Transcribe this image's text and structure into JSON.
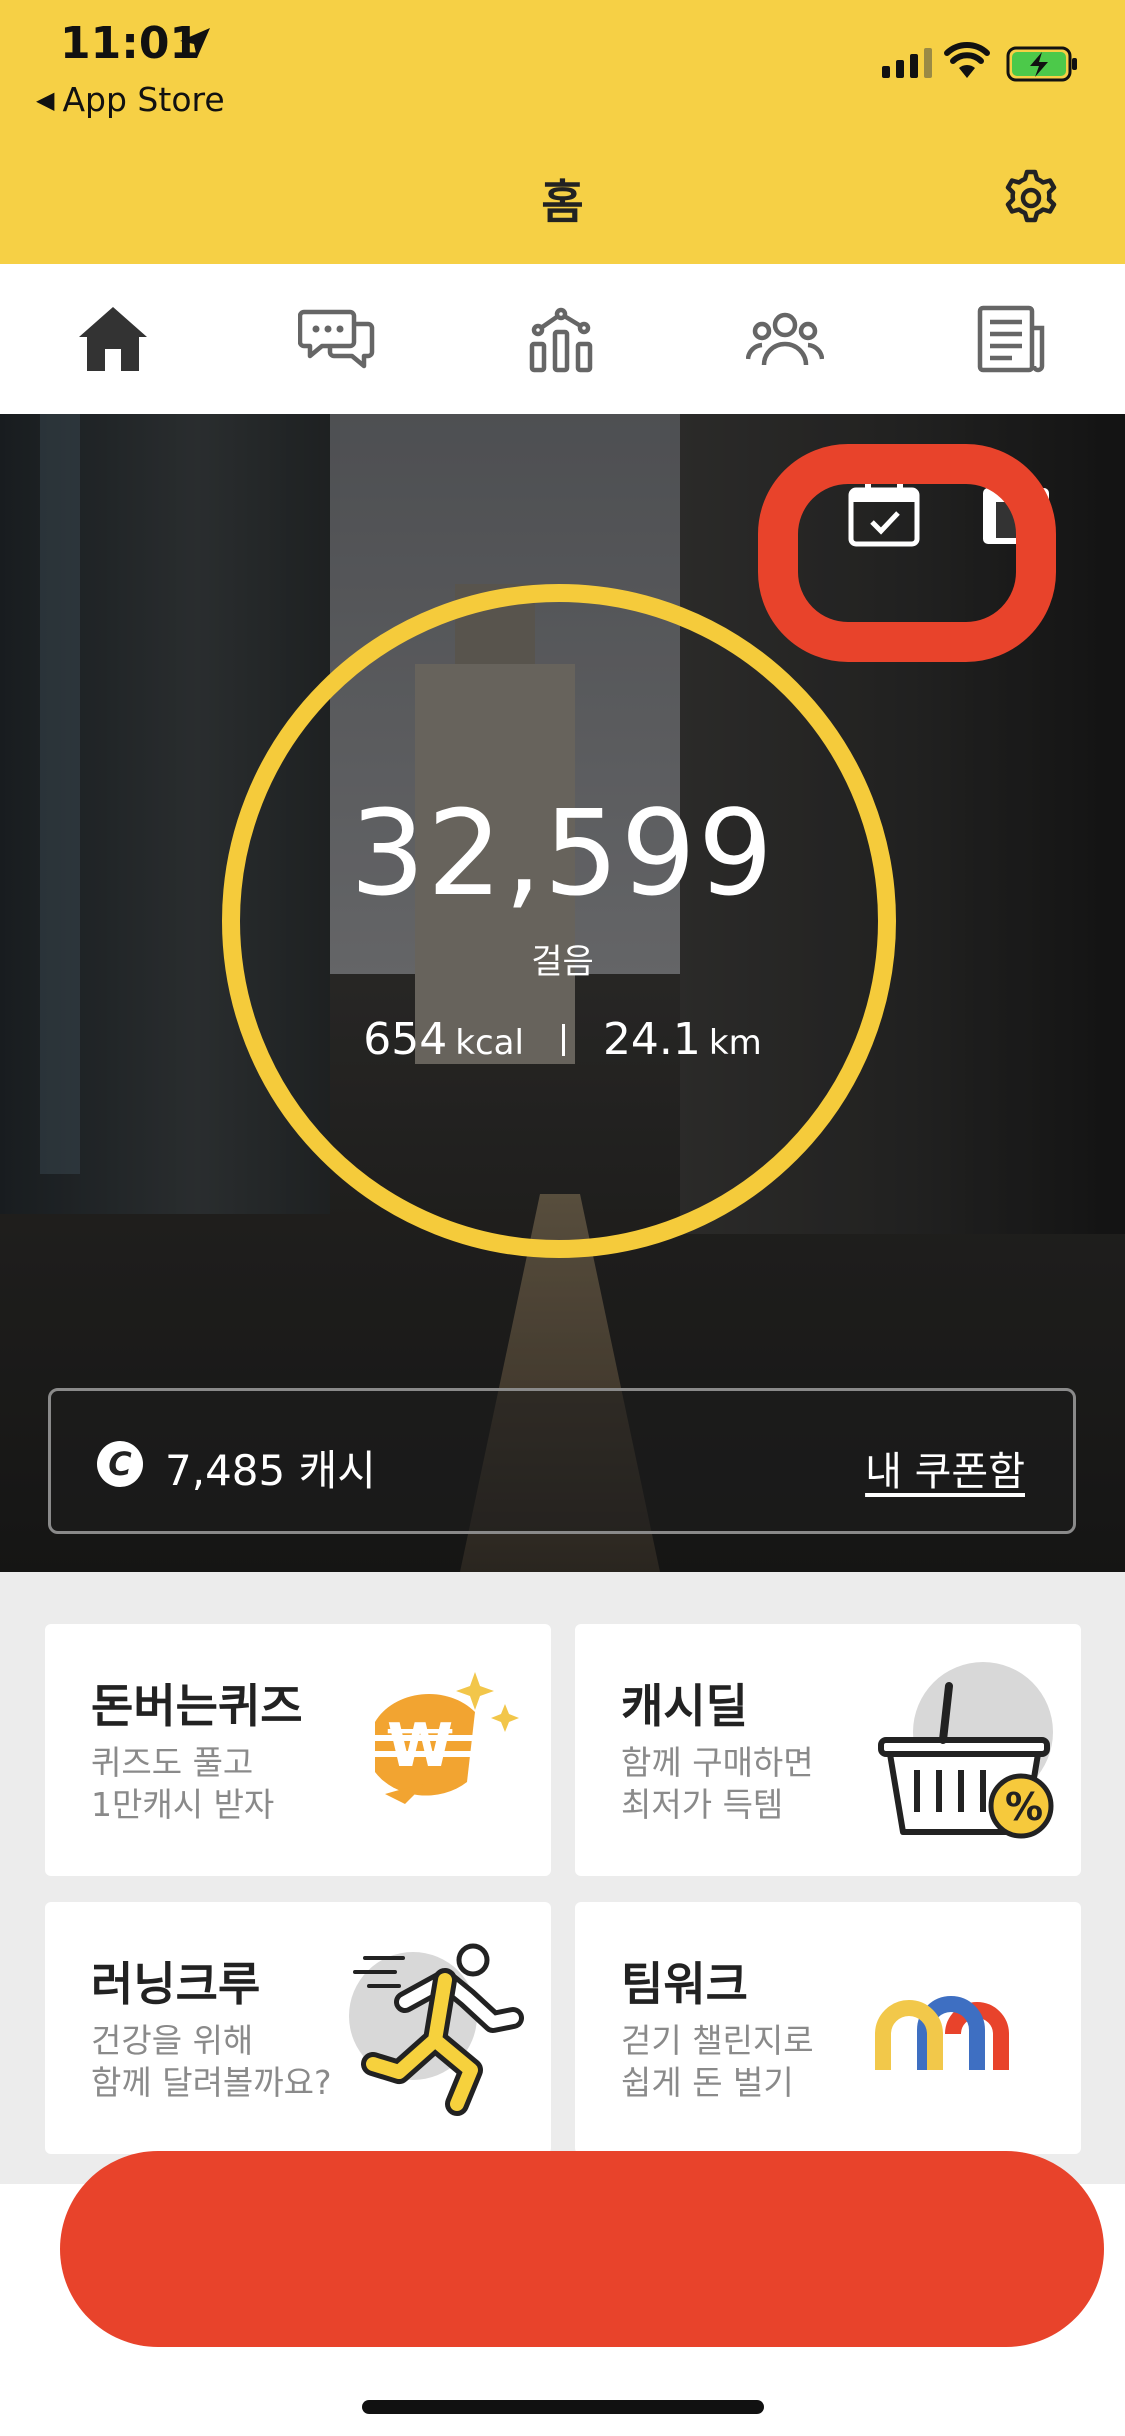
{
  "status_bar": {
    "time": "11:01",
    "back_app": "App Store"
  },
  "header": {
    "title": "홈",
    "settings_icon": "gear-icon",
    "background_color": "#f6d045"
  },
  "tabs": [
    {
      "icon": "home-icon",
      "active": true
    },
    {
      "icon": "chat-icon",
      "active": false
    },
    {
      "icon": "stats-icon",
      "active": false
    },
    {
      "icon": "friends-icon",
      "active": false
    },
    {
      "icon": "news-icon",
      "active": false
    }
  ],
  "hero": {
    "steps": "32,599",
    "steps_label": "걸음",
    "kcal_value": "654",
    "kcal_unit": "kcal",
    "km_value": "24.1",
    "km_unit": "km",
    "ring_color": "#f5cb3b",
    "highlight_color": "#e8432b"
  },
  "cash": {
    "coin_symbol": "C",
    "amount_text": "7,485 캐시",
    "coupon_link": "내 쿠폰함"
  },
  "cards": [
    {
      "title": "돈버는퀴즈",
      "sub1": "퀴즈도 풀고",
      "sub2": "1만캐시 받자"
    },
    {
      "title": "캐시딜",
      "sub1": "함께 구매하면",
      "sub2": "최저가 득템"
    },
    {
      "title": "러닝크루",
      "sub1": "건강을 위해",
      "sub2": "함께 달려볼까요?"
    },
    {
      "title": "팀워크",
      "sub1": "걷기 챌린지로",
      "sub2": "쉽게 돈 벌기"
    }
  ]
}
